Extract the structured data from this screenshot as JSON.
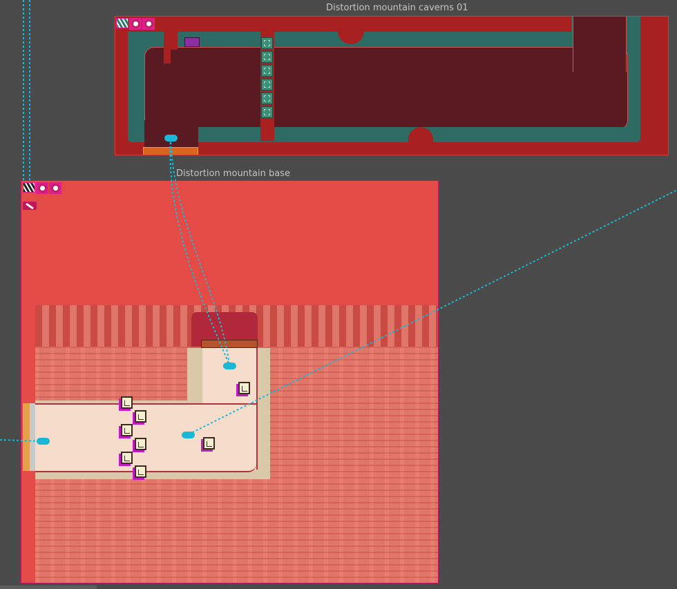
{
  "rooms": [
    {
      "id": "caverns",
      "title": "Distortion mountain caverns 01"
    },
    {
      "id": "base",
      "title": "Distortion mountain base"
    }
  ],
  "colors": {
    "background": "#4a4a4a",
    "title_text": "#c4c4c4",
    "warp_link": "#1ab7d6",
    "cavern_wall": "#a92020",
    "cavern_floor": "#5a1a22",
    "cavern_teal": "#2e6a64",
    "base_sky": "#e54b46",
    "base_rock": "#e0766a",
    "base_path": "#f5dccb",
    "room_border": "#c2185b"
  },
  "icons": [
    "tileset-icon",
    "layer-ring-icon",
    "layer-ring-icon"
  ]
}
